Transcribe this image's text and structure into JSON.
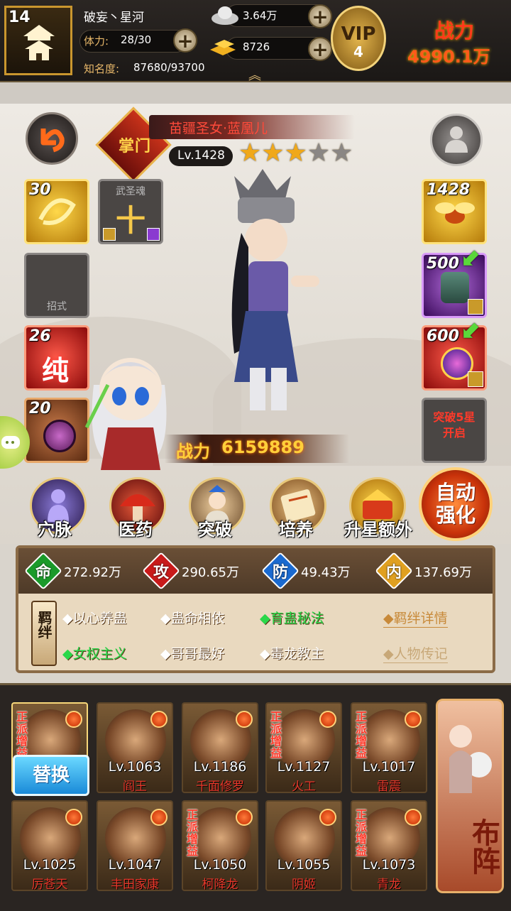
{
  "player": {
    "level": "14",
    "name": "破妄丶星河",
    "stamina_label": "体力:",
    "stamina_value": "28/30",
    "fame_label": "知名度:",
    "fame_value": "87680/93700"
  },
  "currency": {
    "silver": "3.64万",
    "gold": "8726"
  },
  "vip": {
    "label": "VIP",
    "level": "4"
  },
  "power": {
    "label": "战力",
    "value": "4990.1万"
  },
  "hero": {
    "faction": "掌门",
    "title": "苗疆圣女·蓝凰儿",
    "level": "Lv.1428",
    "stars_filled": 3,
    "stars_total": 5,
    "power_label": "战力",
    "power_value": "6159889"
  },
  "left_slots": [
    {
      "num": "30"
    },
    {
      "label": "武圣魂",
      "glyph": "十"
    },
    {
      "label": "招式"
    },
    {
      "num": "26",
      "glyph": "纯"
    },
    {
      "num": "20"
    }
  ],
  "right_slots": [
    {
      "num": "1428"
    },
    {
      "num": "500"
    },
    {
      "num": "600"
    },
    {
      "text": "突破5星开启"
    }
  ],
  "menu": [
    {
      "label": "穴脉"
    },
    {
      "label": "医药"
    },
    {
      "label": "突破"
    },
    {
      "label": "培养"
    },
    {
      "label": "升星额外"
    }
  ],
  "auto_strengthen": "自动强化",
  "stats": [
    {
      "char": "命",
      "value": "272.92万",
      "color": "#1a9a2a"
    },
    {
      "char": "攻",
      "value": "290.65万",
      "color": "#c81a1a"
    },
    {
      "char": "防",
      "value": "49.43万",
      "color": "#1a6ad0"
    },
    {
      "char": "内",
      "value": "137.69万",
      "color": "#e0a020"
    }
  ],
  "bond_label": "羁绊",
  "bonds": [
    {
      "text": "◆以心养蛊",
      "active": false
    },
    {
      "text": "◆蛊命相依",
      "active": false
    },
    {
      "text": "◆育蛊秘法",
      "active": true
    },
    {
      "text": "◆女权主义",
      "active": true
    },
    {
      "text": "◆哥哥最好",
      "active": false
    },
    {
      "text": "◆毒龙教主",
      "active": false
    }
  ],
  "links": {
    "bond_detail": "◆羁绊详情",
    "biography": "◆人物传记"
  },
  "replace_label": "替换",
  "roster": [
    {
      "level": "",
      "name": "",
      "tag": "正派增益"
    },
    {
      "level": "Lv.1063",
      "name": "阎王",
      "tag": ""
    },
    {
      "level": "Lv.1186",
      "name": "千面修罗",
      "tag": ""
    },
    {
      "level": "Lv.1127",
      "name": "火工",
      "tag": "正派增益"
    },
    {
      "level": "Lv.1017",
      "name": "雷震",
      "tag": "正派增益"
    },
    {
      "level": "Lv.1025",
      "name": "厉苍天",
      "tag": ""
    },
    {
      "level": "Lv.1047",
      "name": "丰田家康",
      "tag": ""
    },
    {
      "level": "Lv.1050",
      "name": "柯降龙",
      "tag": "正派增益"
    },
    {
      "level": "Lv.1055",
      "name": "阴姬",
      "tag": ""
    },
    {
      "level": "Lv.1073",
      "name": "青龙",
      "tag": "正派增益"
    }
  ],
  "formation_label": "布阵"
}
